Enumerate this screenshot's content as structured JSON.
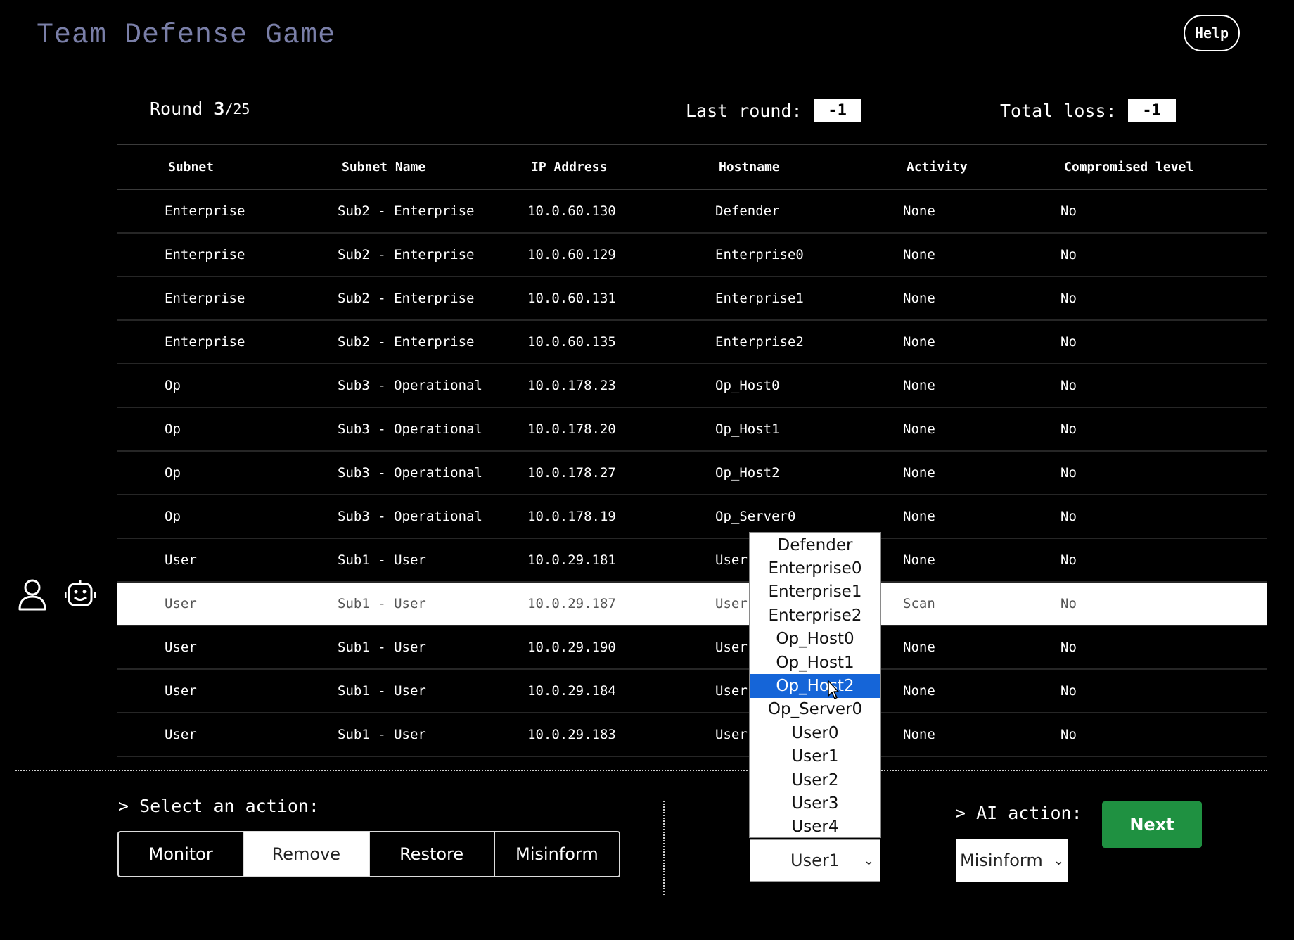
{
  "app": {
    "title": "Team Defense Game",
    "help_label": "Help"
  },
  "stats": {
    "round_label": "Round",
    "round_current": "3",
    "round_total": "/25",
    "last_round_label": "Last round:",
    "last_round_value": "-1",
    "total_loss_label": "Total loss:",
    "total_loss_value": "-1"
  },
  "table": {
    "headers": [
      "Subnet",
      "Subnet Name",
      "IP Address",
      "Hostname",
      "Activity",
      "Compromised level"
    ],
    "rows": [
      [
        "Enterprise",
        "Sub2 - Enterprise",
        "10.0.60.130",
        "Defender",
        "None",
        "No"
      ],
      [
        "Enterprise",
        "Sub2 - Enterprise",
        "10.0.60.129",
        "Enterprise0",
        "None",
        "No"
      ],
      [
        "Enterprise",
        "Sub2 - Enterprise",
        "10.0.60.131",
        "Enterprise1",
        "None",
        "No"
      ],
      [
        "Enterprise",
        "Sub2 - Enterprise",
        "10.0.60.135",
        "Enterprise2",
        "None",
        "No"
      ],
      [
        "Op",
        "Sub3 - Operational",
        "10.0.178.23",
        "Op_Host0",
        "None",
        "No"
      ],
      [
        "Op",
        "Sub3 - Operational",
        "10.0.178.20",
        "Op_Host1",
        "None",
        "No"
      ],
      [
        "Op",
        "Sub3 - Operational",
        "10.0.178.27",
        "Op_Host2",
        "None",
        "No"
      ],
      [
        "Op",
        "Sub3 - Operational",
        "10.0.178.19",
        "Op_Server0",
        "None",
        "No"
      ],
      [
        "User",
        "Sub1 - User",
        "10.0.29.181",
        "User",
        "None",
        "No"
      ],
      [
        "User",
        "Sub1 - User",
        "10.0.29.187",
        "User",
        "Scan",
        "No"
      ],
      [
        "User",
        "Sub1 - User",
        "10.0.29.190",
        "User",
        "None",
        "No"
      ],
      [
        "User",
        "Sub1 - User",
        "10.0.29.184",
        "User",
        "None",
        "No"
      ],
      [
        "User",
        "Sub1 - User",
        "10.0.29.183",
        "User",
        "None",
        "No"
      ]
    ],
    "selected_row_index": 9
  },
  "icons": {
    "user": "user-icon",
    "bot": "robot-icon"
  },
  "actions": {
    "label": "> Select an action:",
    "buttons": [
      "Monitor",
      "Remove",
      "Restore",
      "Misinform"
    ],
    "active": "Remove"
  },
  "host_dropdown": {
    "selected": "User1",
    "options": [
      "Defender",
      "Enterprise0",
      "Enterprise1",
      "Enterprise2",
      "Op_Host0",
      "Op_Host1",
      "Op_Host2",
      "Op_Server0",
      "User0",
      "User1",
      "User2",
      "User3",
      "User4"
    ],
    "highlighted": "Op_Host2"
  },
  "ai": {
    "label": "> AI action:",
    "selected": "Misinform"
  },
  "next_label": "Next",
  "colors": {
    "title": "#7a7fa8",
    "next_button": "#1f9141",
    "highlight": "#1565d8"
  }
}
